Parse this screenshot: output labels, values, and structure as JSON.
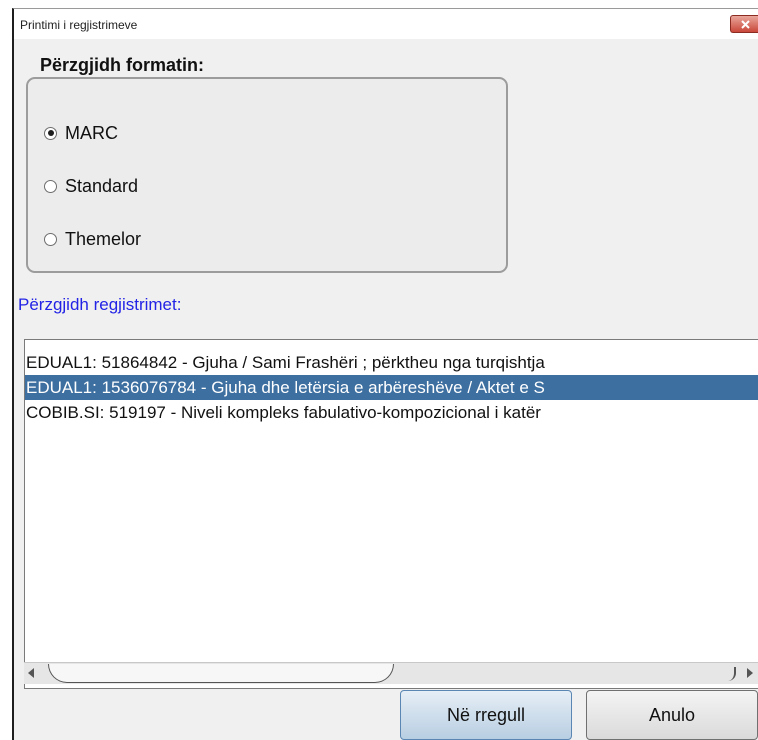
{
  "window": {
    "title": "Printimi i regjistrimeve",
    "close_icon": "close-icon"
  },
  "format": {
    "heading": "Përzgjidh formatin:",
    "options": [
      {
        "label": "MARC",
        "checked": true
      },
      {
        "label": "Standard",
        "checked": false
      },
      {
        "label": "Themelor",
        "checked": false
      }
    ]
  },
  "records": {
    "label": "Përzgjidh regjistrimet:",
    "items": [
      {
        "text": "EDUAL1: 51864842 - Gjuha / Sami Frashëri ; përktheu nga turqishtja",
        "selected": false
      },
      {
        "text": "EDUAL1: 1536076784 - Gjuha dhe letërsia e arbëreshëve / Aktet e S",
        "selected": true
      },
      {
        "text": "COBIB.SI: 519197 - Niveli kompleks fabulativo-kompozicional i katër",
        "selected": false
      }
    ],
    "selection_color": "#3d6fa0"
  },
  "buttons": {
    "ok": "Në rregull",
    "cancel": "Anulo"
  }
}
